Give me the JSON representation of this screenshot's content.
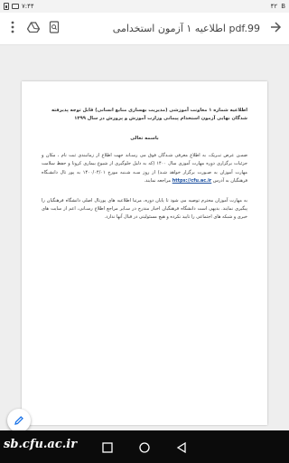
{
  "status_bar": {
    "time": "۷:۴۴",
    "notifications": [
      "۴۲",
      "B"
    ]
  },
  "app_bar": {
    "title": "اطلاعیه ۱ آزمون استخدامی pdf.99",
    "icons": [
      "back-arrow-icon",
      "search-icon",
      "google-drive-icon",
      "more-vert-icon"
    ]
  },
  "document": {
    "title": "اطلاعیه شماره ۱ معاونت آموزشی (مدیریت بهسازی منابع انسانی) قابل توجه پذیرفته شدگان نهایی آزمون استخدام پیمانی وزارت آموزش و پرورش در سال ۱۳۹۹",
    "heading": "باسمه تعالی",
    "paragraph1_a": "ضمـن عرض تبـریک، به اطلاع معرفی شـدگان فوق می رسـاند جهت اطلاع از زمانبندی ثبت نام ، مکان و جزئیات برگزاری دوره مهارت آموزی سال ۱۴۰۰ (که به دلیل جلوگیری از شیوع بیماری کرونا و حفظ سلامت مهارت آموزان به صـورت برگزار خواهد شـد) از روز سـه شـنبه مورخ ۱۴۰۰/۰۴/۰۱ به پور تال دانشـگاه فرهنگیان به آدرس",
    "link": "https://cfu.ac.ir",
    "paragraph1_b": "مراجعه نمایند.",
    "paragraph2": "به مهارت آموزان محترم توصیه می شود تا پایان دوره، مرتبا اطلاعیه های پورتال اصلی دانشگاه فرهنگیان را پیگیری نمایند. بدیهی است دانشگاه فرهنگیان اخبار مندرج در سـایر مراجع اطلاع رسـانی، اعم از سایت های خبری و شبکه های اجتماعی را تایید نکرده و هیچ مسئولیتی در قبال آنها ندارد."
  },
  "fab": {
    "icon": "edit-pencil-icon"
  },
  "bottom_bar": {
    "watermark": "sb.cfu.ac.ir",
    "nav_icons": [
      "back-icon",
      "home-icon",
      "recents-icon"
    ]
  },
  "colors": {
    "accent": "#1a73e8",
    "link": "#1a4fa0",
    "nav_bar": "#0b0b0b"
  }
}
